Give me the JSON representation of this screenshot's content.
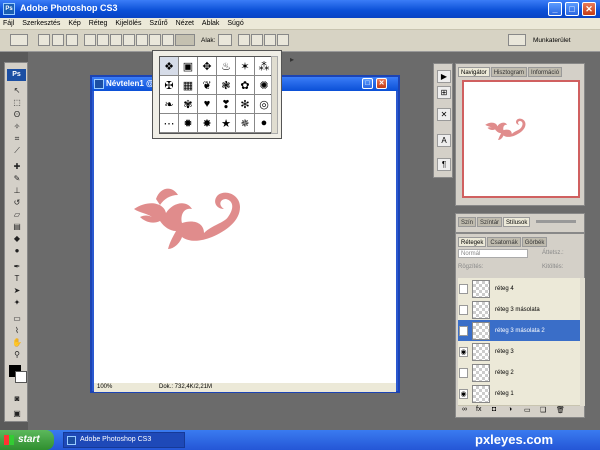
{
  "window": {
    "title": "Adobe Photoshop CS3",
    "app_icon": "Ps"
  },
  "menu": [
    "Fájl",
    "Szerkesztés",
    "Kép",
    "Réteg",
    "Kijelölés",
    "Szűrő",
    "Nézet",
    "Ablak",
    "Súgó"
  ],
  "options_bar": {
    "shape_label": "Alak:",
    "workspace_label": "Munkaterület"
  },
  "toolbox": {
    "logo": "Ps"
  },
  "document": {
    "title": "Névtelen1 @",
    "zoom": "100%",
    "status": "Dok.: 732,4K/2,21M"
  },
  "shape_picker": {
    "icons": [
      "❖",
      "▣",
      "✥",
      "♨",
      "✶",
      "⁂",
      "✠",
      "▦",
      "❦",
      "❃",
      "✿",
      "✺",
      "❧",
      "✾",
      "♥",
      "❣",
      "✻",
      "◎",
      "⋯",
      "✹",
      "✸",
      "★",
      "✵",
      "●"
    ],
    "menu_arrow": "▸"
  },
  "navigator": {
    "tabs": [
      "Navigátor",
      "Hisztogram",
      "Információ"
    ]
  },
  "styles": {
    "tabs": [
      "Szín",
      "Színtár",
      "Stílusok"
    ]
  },
  "layers": {
    "tabs": [
      "Rétegek",
      "Csatornák",
      "Görbék"
    ],
    "blend_mode": "Normál",
    "opacity_label": "Áttetsz.:",
    "lock_label": "Rögzítés:",
    "fill_label": "Kitöltés:",
    "rows": [
      {
        "name": "réteg 4",
        "visible": false,
        "selected": false
      },
      {
        "name": "réteg 3 másolata",
        "visible": false,
        "selected": false
      },
      {
        "name": "réteg 3 másolata 2",
        "visible": false,
        "selected": true
      },
      {
        "name": "réteg 3",
        "visible": true,
        "selected": false
      },
      {
        "name": "réteg 2",
        "visible": false,
        "selected": false
      },
      {
        "name": "réteg 1",
        "visible": true,
        "selected": false
      }
    ]
  },
  "taskbar": {
    "start": "start",
    "task": "Adobe Photoshop CS3"
  },
  "watermark": "pxleyes.com",
  "colors": {
    "accent": "#0a4fd6",
    "flourish": "#e08c8c",
    "selected_layer": "#3a6ec8"
  }
}
